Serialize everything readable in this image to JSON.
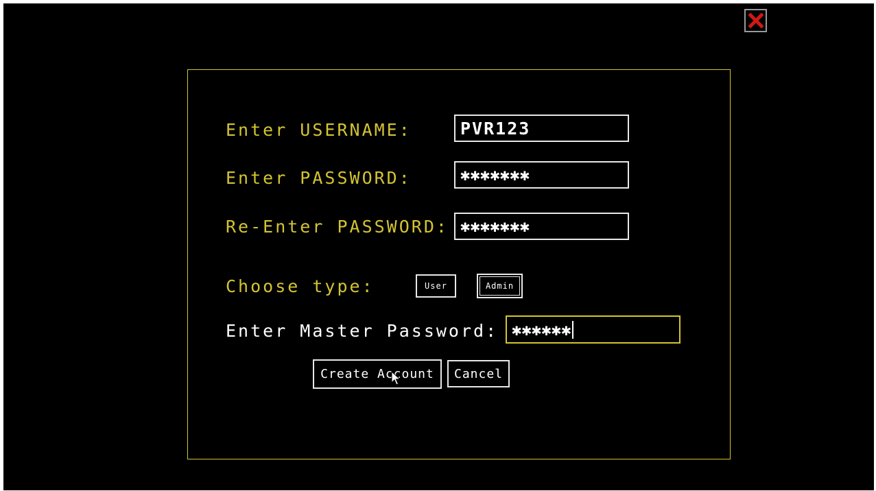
{
  "window": {
    "close_icon": "close-icon",
    "close_color": "#d01818"
  },
  "form": {
    "username_label": "Enter USERNAME:",
    "username_value": "PVR123",
    "password_label": "Enter PASSWORD:",
    "password_value": "✱✱✱✱✱✱✱",
    "reenter_label": "Re-Enter PASSWORD:",
    "reenter_value": "✱✱✱✱✱✱✱",
    "type_label": "Choose type:",
    "type_options": [
      "User",
      "Admin"
    ],
    "type_selected": "Admin",
    "master_label": "Enter Master Password:",
    "master_value": "✱✱✱✱✱✱",
    "create_button": "Create Account",
    "cancel_button": "Cancel"
  },
  "colors": {
    "label": "#d4c433",
    "text": "#ffffff",
    "background": "#000000"
  }
}
